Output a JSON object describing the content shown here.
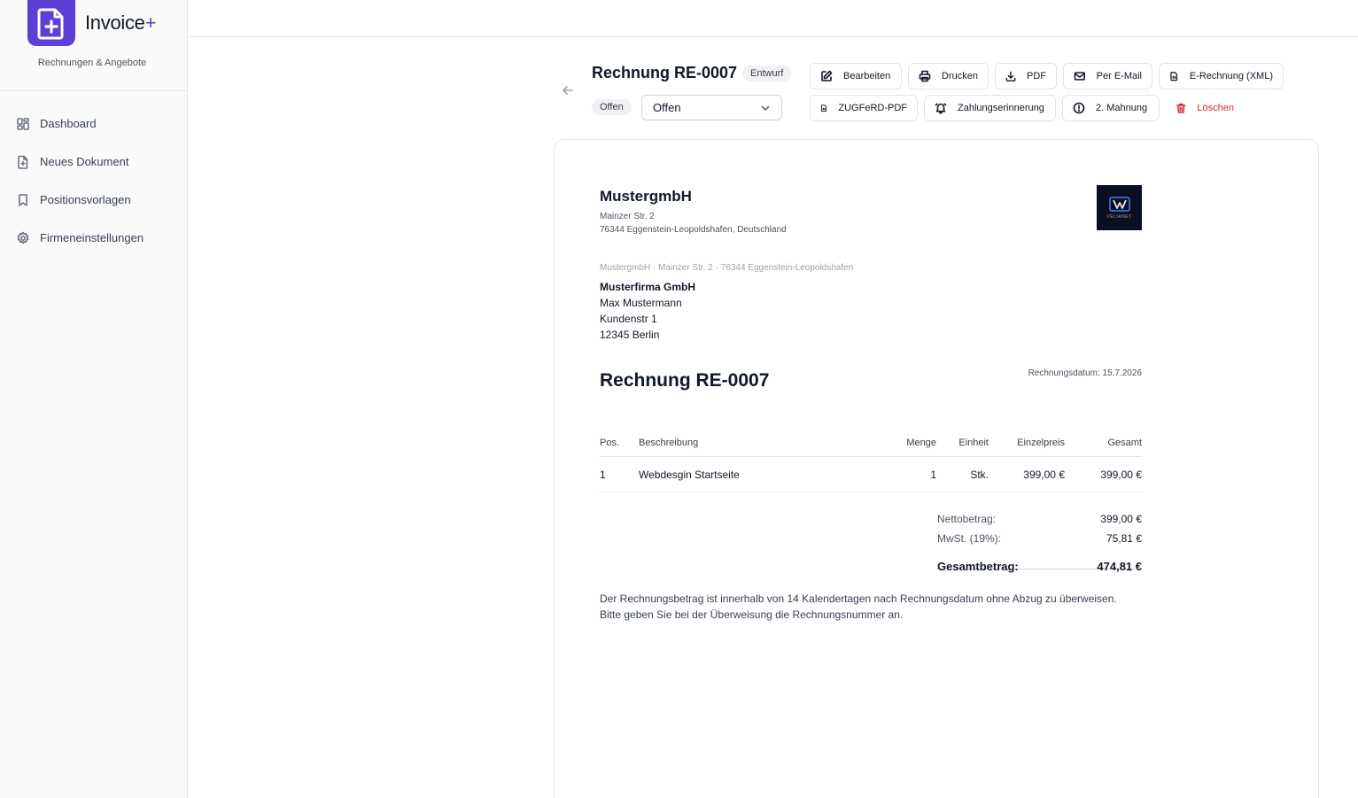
{
  "brand": {
    "name": "Invoice",
    "plus": "+",
    "subtitle": "Rechnungen & Angebote",
    "accent": "#5b3fd6"
  },
  "sidebar": {
    "items": [
      {
        "label": "Dashboard",
        "icon": "dashboard-icon"
      },
      {
        "label": "Neues Dokument",
        "icon": "file-plus-icon"
      },
      {
        "label": "Positionsvorlagen",
        "icon": "bookmark-icon"
      },
      {
        "label": "Firmeneinstellungen",
        "icon": "gear-icon"
      }
    ]
  },
  "header": {
    "title": "Rechnung RE-0007",
    "draft_badge": "Entwurf",
    "status_badge": "Offen",
    "status_select": "Offen"
  },
  "actions": {
    "edit": "Bearbeiten",
    "print": "Drucken",
    "pdf": "PDF",
    "email": "Per E-Mail",
    "xrechnung": "E-Rechnung (XML)",
    "zugferd": "ZUGFeRD-PDF",
    "reminder": "Zahlungserinnerung",
    "dunning": "2. Mahnung",
    "delete": "Löschen"
  },
  "document": {
    "sender": {
      "name": "MustergmbH",
      "street": "Mainzer Str. 2",
      "city": "76344 Eggenstein-Leopoldshafen, Deutschland",
      "logo_text": "VELIANET"
    },
    "return_line": "MustergmbH · Mainzer Str. 2 · 76344 Eggenstein-Leopoldshafen",
    "recipient": {
      "company": "Musterfirma GmbH",
      "person": "Max Mustermann",
      "street": "Kundenstr 1",
      "city": "12345 Berlin"
    },
    "title": "Rechnung RE-0007",
    "date": "Rechnungsdatum: 15.7.2026",
    "table": {
      "headers": {
        "pos": "Pos.",
        "desc": "Beschreibung",
        "qty": "Menge",
        "unit": "Einheit",
        "unit_price": "Einzelpreis",
        "total": "Gesamt"
      },
      "rows": [
        {
          "pos": "1",
          "desc": "Webdesgin Startseite",
          "qty": "1",
          "unit": "Stk.",
          "unit_price": "399,00 €",
          "total": "399,00 €"
        }
      ]
    },
    "totals": {
      "net_label": "Nettobetrag:",
      "net": "399,00 €",
      "vat_label": "MwSt. (19%):",
      "vat": "75,81 €",
      "gross_label": "Gesamtbetrag:",
      "gross": "474,81 €"
    },
    "footer_line1": "Der Rechnungsbetrag ist innerhalb von 14 Kalendertagen nach Rechnungsdatum ohne Abzug zu überweisen.",
    "footer_line2": "Bitte geben Sie bei der Überweisung die Rechnungsnummer an."
  }
}
